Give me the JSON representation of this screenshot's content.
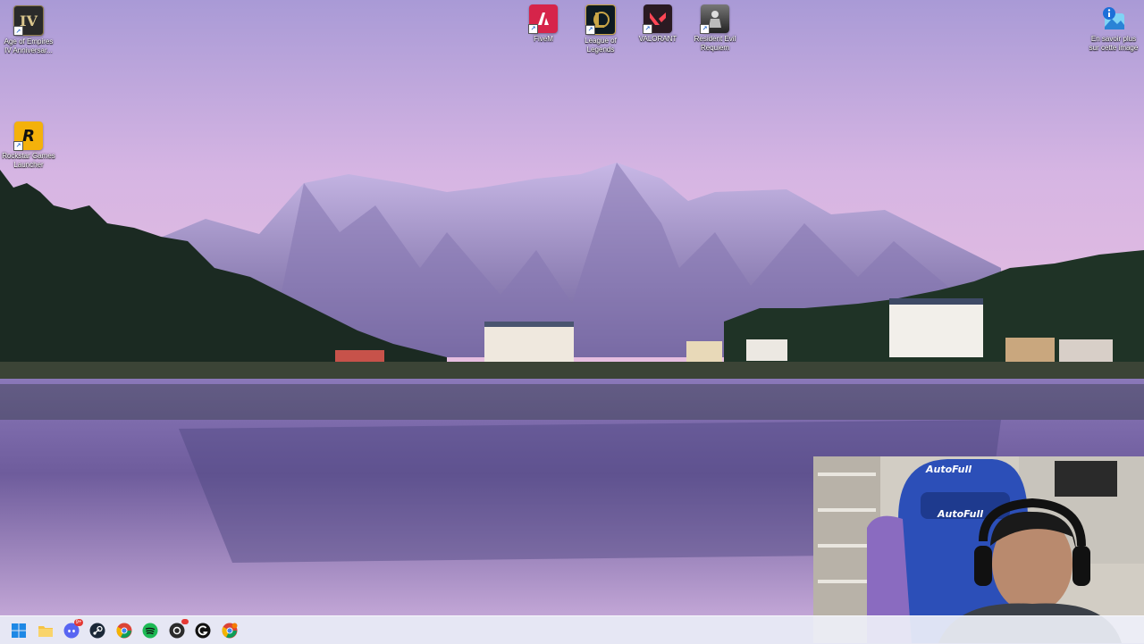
{
  "desktop": {
    "icons": [
      {
        "label": "Age of Empires IV Anniversar...",
        "icon": "age-of-empires-icon"
      },
      {
        "label": "Rockstar Games Launcher",
        "icon": "rockstar-icon"
      },
      {
        "label": "FiveM",
        "icon": "fivem-icon"
      },
      {
        "label": "League of Legends",
        "icon": "league-icon"
      },
      {
        "label": "VALORANT",
        "icon": "valorant-icon"
      },
      {
        "label": "Resident Evil Requiem",
        "icon": "resident-evil-icon"
      },
      {
        "label": "En savoir plus sur cette image",
        "icon": "spotlight-icon"
      }
    ],
    "glyph_text": {
      "aoe": "IV",
      "rockstar": "R"
    }
  },
  "taskbar": {
    "apps": [
      {
        "name": "Start",
        "icon": "windows-icon"
      },
      {
        "name": "File Explorer",
        "icon": "folder-icon"
      },
      {
        "name": "Discord",
        "icon": "discord-icon",
        "badge": "9+"
      },
      {
        "name": "Steam",
        "icon": "steam-icon"
      },
      {
        "name": "Google Chrome",
        "icon": "chrome-icon"
      },
      {
        "name": "Spotify",
        "icon": "spotify-icon"
      },
      {
        "name": "App",
        "icon": "app-icon"
      },
      {
        "name": "G Hub",
        "icon": "ghub-icon"
      },
      {
        "name": "Chrome Profile",
        "icon": "chrome-profile-icon"
      }
    ]
  },
  "webcam": {
    "chair_brand": "AutoFull",
    "chair_brand_2": "AutoFull"
  },
  "colors": {
    "sky_top": "#b9a4dc",
    "sky_mid": "#d8b6e2",
    "water": "#7c6aa8",
    "taskbar": "#eef0f8"
  }
}
